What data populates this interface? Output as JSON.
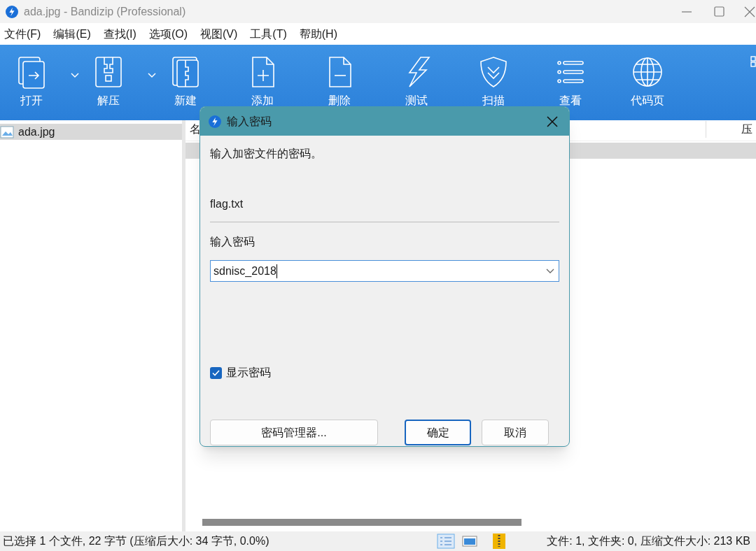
{
  "window": {
    "title": "ada.jpg - Bandizip (Professional)"
  },
  "menu": [
    "文件(F)",
    "编辑(E)",
    "查找(I)",
    "选项(O)",
    "视图(V)",
    "工具(T)",
    "帮助(H)"
  ],
  "toolbar": [
    {
      "label": "打开",
      "kind": "open",
      "dropdown": true
    },
    {
      "label": "解压",
      "kind": "extract",
      "dropdown": true
    },
    {
      "label": "新建",
      "kind": "new",
      "dropdown": false
    },
    {
      "label": "添加",
      "kind": "add",
      "dropdown": false
    },
    {
      "label": "删除",
      "kind": "delete",
      "dropdown": false
    },
    {
      "label": "测试",
      "kind": "test",
      "dropdown": false
    },
    {
      "label": "扫描",
      "kind": "scan",
      "dropdown": false
    },
    {
      "label": "查看",
      "kind": "view",
      "dropdown": false
    },
    {
      "label": "代码页",
      "kind": "codepage",
      "dropdown": false
    }
  ],
  "tree": {
    "items": [
      {
        "label": "ada.jpg",
        "selected": true
      }
    ]
  },
  "file_list": {
    "columns": [
      "名",
      "压"
    ],
    "rows": [
      {
        "selected": true
      }
    ]
  },
  "dialog": {
    "title": "输入密码",
    "message": "输入加密文件的密码。",
    "file_name": "flag.txt",
    "password_label": "输入密码",
    "password_value": "sdnisc_2018",
    "show_password": {
      "label": "显示密码",
      "checked": true
    },
    "buttons": [
      {
        "label": "密码管理器...",
        "default": false
      },
      {
        "label": "确定",
        "default": true
      },
      {
        "label": "取消",
        "default": false
      }
    ]
  },
  "status_bar": {
    "selection": "已选择 1 个文件, 22 字节 (压缩后大小: 34 字节, 0.0%)",
    "summary": "文件: 1, 文件夹: 0, 压缩文件大小: 213 KB"
  }
}
